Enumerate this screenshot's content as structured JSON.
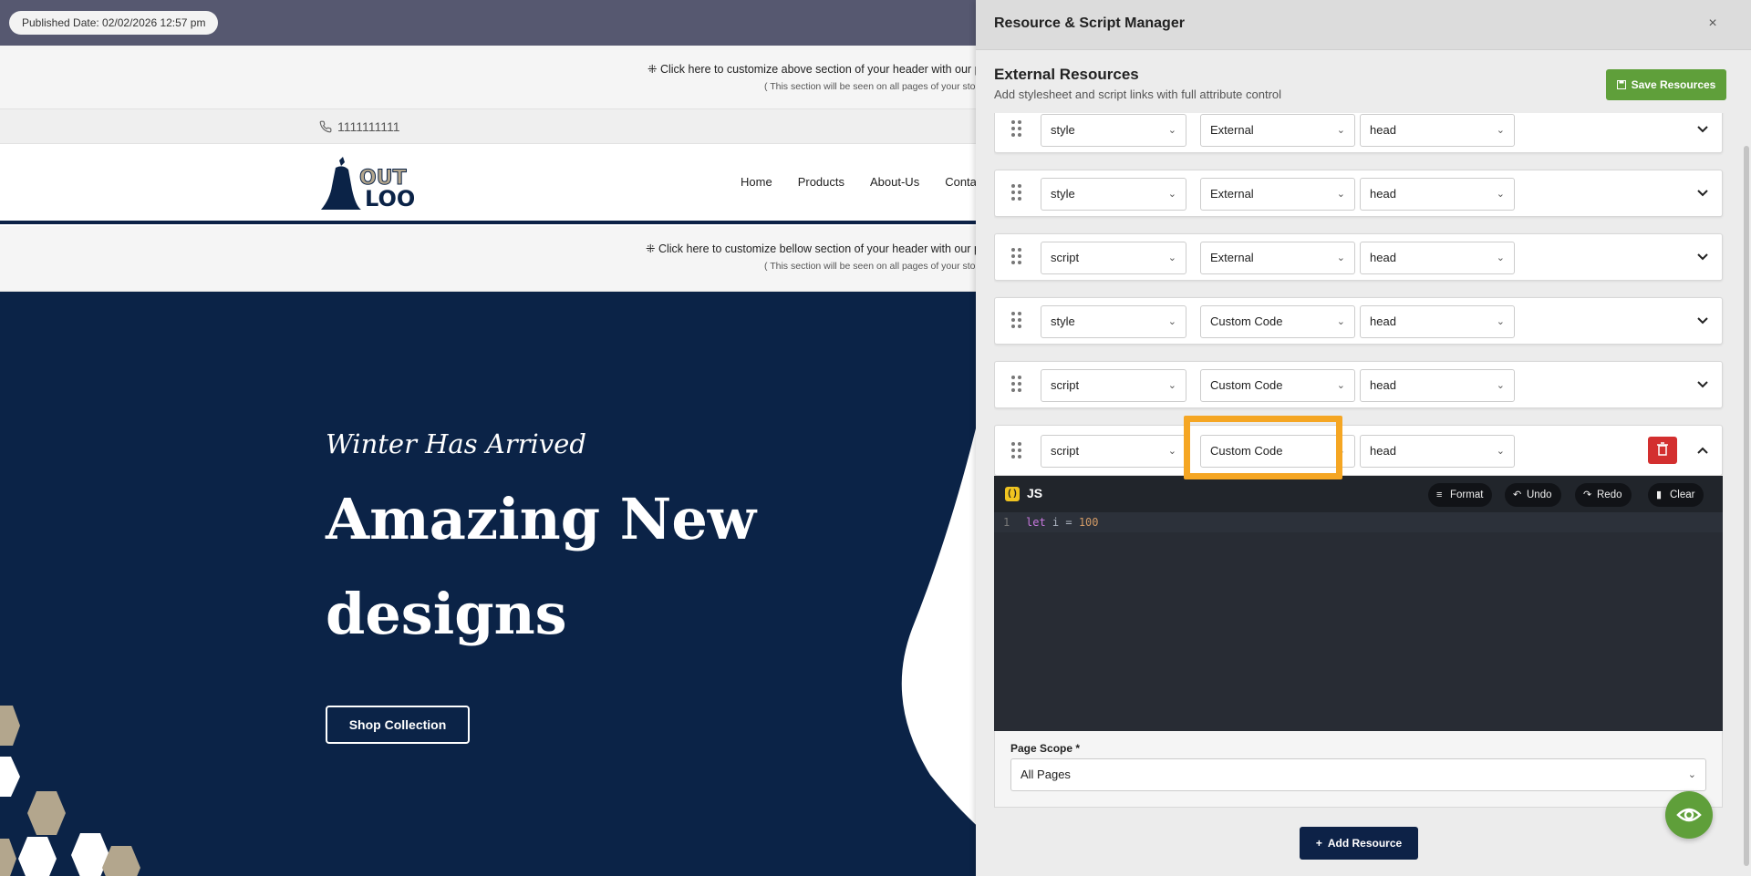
{
  "site": {
    "published_badge": "Published Date: 02/02/2026 12:57 pm",
    "above_band": {
      "line1": "⁜ Click here to customize above section of your header with our p",
      "line2": "( This section will be seen on all pages of your stor"
    },
    "phone": "1111111111",
    "nav": [
      "Home",
      "Products",
      "About-Us",
      "Conta"
    ],
    "below_band": {
      "line1": "⁜ Click here to customize bellow section of your header with our p",
      "line2": "( This section will be seen on all pages of your stor"
    },
    "hero": {
      "tagline": "Winter Has Arrived",
      "heading": "Amazing New designs",
      "cta": "Shop Collection"
    },
    "colors": {
      "navy": "#0b2347",
      "tan": "#b3a68d"
    }
  },
  "panel": {
    "title": "Resource & Script Manager",
    "close": "×",
    "section_title": "External Resources",
    "section_subtitle": "Add stylesheet and script links with full attribute control",
    "save_label": "Save Resources",
    "rows": [
      {
        "type": "style",
        "source": "External",
        "location": "head",
        "expanded": false
      },
      {
        "type": "style",
        "source": "External",
        "location": "head",
        "expanded": false
      },
      {
        "type": "script",
        "source": "External",
        "location": "head",
        "expanded": false
      },
      {
        "type": "style",
        "source": "Custom Code",
        "location": "head",
        "expanded": false
      },
      {
        "type": "script",
        "source": "Custom Code",
        "location": "head",
        "expanded": false
      },
      {
        "type": "script",
        "source": "Custom Code",
        "location": "head",
        "expanded": true
      }
    ],
    "editor": {
      "language": "JS",
      "buttons": {
        "format": "Format",
        "undo": "Undo",
        "redo": "Redo",
        "clear": "Clear"
      },
      "line_number": "1",
      "code_keyword": "let",
      "code_var": " i = ",
      "code_num": "100"
    },
    "page_scope": {
      "label": "Page Scope *",
      "value": "All Pages"
    },
    "add_label": "Add Resource",
    "colors": {
      "save": "#5f9f3a",
      "delete": "#d32f2f",
      "highlight": "#f5a623",
      "editor_bg": "#282c34"
    }
  }
}
